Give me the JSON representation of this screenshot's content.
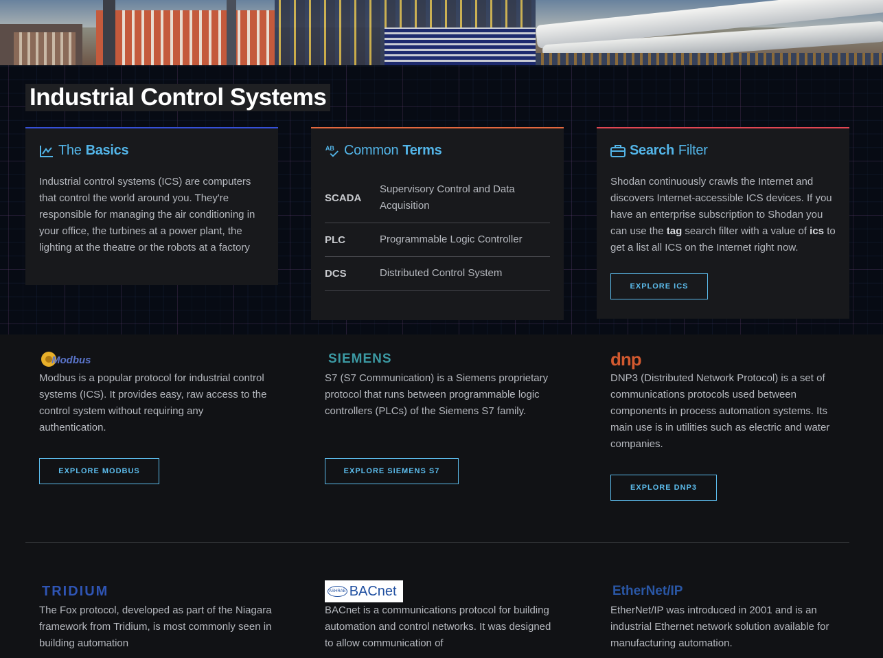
{
  "page_title": "Industrial Control Systems",
  "basics": {
    "title_plain": "The",
    "title_bold": "Basics",
    "text": "Industrial control systems (ICS) are computers that control the world around you. They're responsible for managing the air conditioning in your office, the turbines at a power plant, the lighting at the theatre or the robots at a factory"
  },
  "terms": {
    "title_plain": "Common",
    "title_bold": "Terms",
    "rows": [
      {
        "abbr": "SCADA",
        "definition": "Supervisory Control and Data Acquisition"
      },
      {
        "abbr": "PLC",
        "definition": "Programmable Logic Controller"
      },
      {
        "abbr": "DCS",
        "definition": "Distributed Control System"
      }
    ]
  },
  "search": {
    "title_bold": "Search",
    "title_plain": "Filter",
    "text_1": "Shodan continuously crawls the Internet and discovers Internet-accessible ICS devices. If you have an enterprise subscription to Shodan you can use the",
    "tag": "tag",
    "text_2": "search filter with a value of",
    "ics": "ics",
    "text_3": "to get a list all ICS on the Internet right now.",
    "button": "EXPLORE ICS"
  },
  "protocols": [
    {
      "logo": "Modbus",
      "text": "Modbus is a popular protocol for industrial control systems (ICS). It provides easy, raw access to the control system without requiring any authentication.",
      "button": "EXPLORE MODBUS"
    },
    {
      "logo": "SIEMENS",
      "text": "S7 (S7 Communication) is a Siemens proprietary protocol that runs between programmable logic controllers (PLCs) of the Siemens S7 family.",
      "button": "EXPLORE SIEMENS S7"
    },
    {
      "logo": "dnp",
      "text": "DNP3 (Distributed Network Protocol) is a set of communications protocols used between components in process automation systems. Its main use is in utilities such as electric and water companies.",
      "button": "EXPLORE DNP3"
    },
    {
      "logo": "TRIDIUM",
      "text": "The Fox protocol, developed as part of the Niagara framework from Tridium, is most commonly seen in building automation"
    },
    {
      "logo": "BACnet",
      "logo_badge": "ASHRAE",
      "text": "BACnet is a communications protocol for building automation and control networks. It was designed to allow communication of"
    },
    {
      "logo_part1": "Ether",
      "logo_part2": "Net/IP",
      "text": "EtherNet/IP was introduced in 2001 and is an industrial Ethernet network solution available for manufacturing automation."
    }
  ],
  "colors": {
    "accent": "#5cbcec",
    "basics_bar": "#3550d8",
    "terms_bar": "#e4683f",
    "search_bar": "#e24653"
  }
}
